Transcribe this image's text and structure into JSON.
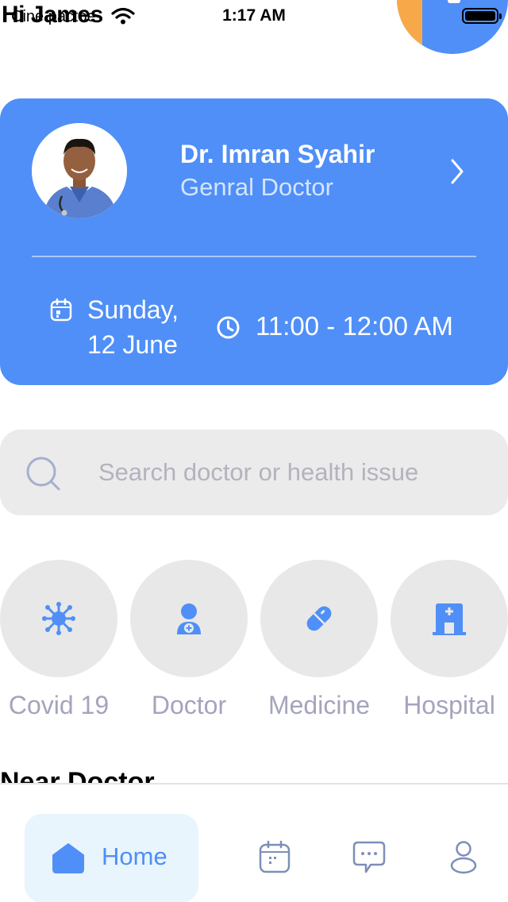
{
  "status_bar": {
    "carrier": "Cine pactoe",
    "time": "1:17 AM"
  },
  "header": {
    "greeting": "Hi James"
  },
  "appointment": {
    "doctor_name": "Dr. Imran Syahir",
    "doctor_role": "Genral Doctor",
    "date_line1": "Sunday,",
    "date_line2": "12 June",
    "time_range": "11:00 - 12:00 AM"
  },
  "search": {
    "placeholder": "Search doctor or health issue"
  },
  "categories": [
    {
      "label": "Covid 19",
      "icon": "virus-icon"
    },
    {
      "label": "Doctor",
      "icon": "doctor-icon"
    },
    {
      "label": "Medicine",
      "icon": "pill-icon"
    },
    {
      "label": "Hospital",
      "icon": "hospital-icon"
    }
  ],
  "near_doctor": {
    "heading": "Near Doctor"
  },
  "tab_bar": {
    "home_label": "Home",
    "tabs": [
      "home-icon",
      "calendar-icon",
      "chat-icon",
      "profile-icon"
    ]
  },
  "colors": {
    "primary": "#4f8ff7",
    "muted_text": "#a4a4bd",
    "category_bg": "#e8e8e8",
    "search_bg": "#ebebeb",
    "home_tab_bg": "#e9f5fd",
    "tab_icon": "#7d8fb8"
  }
}
